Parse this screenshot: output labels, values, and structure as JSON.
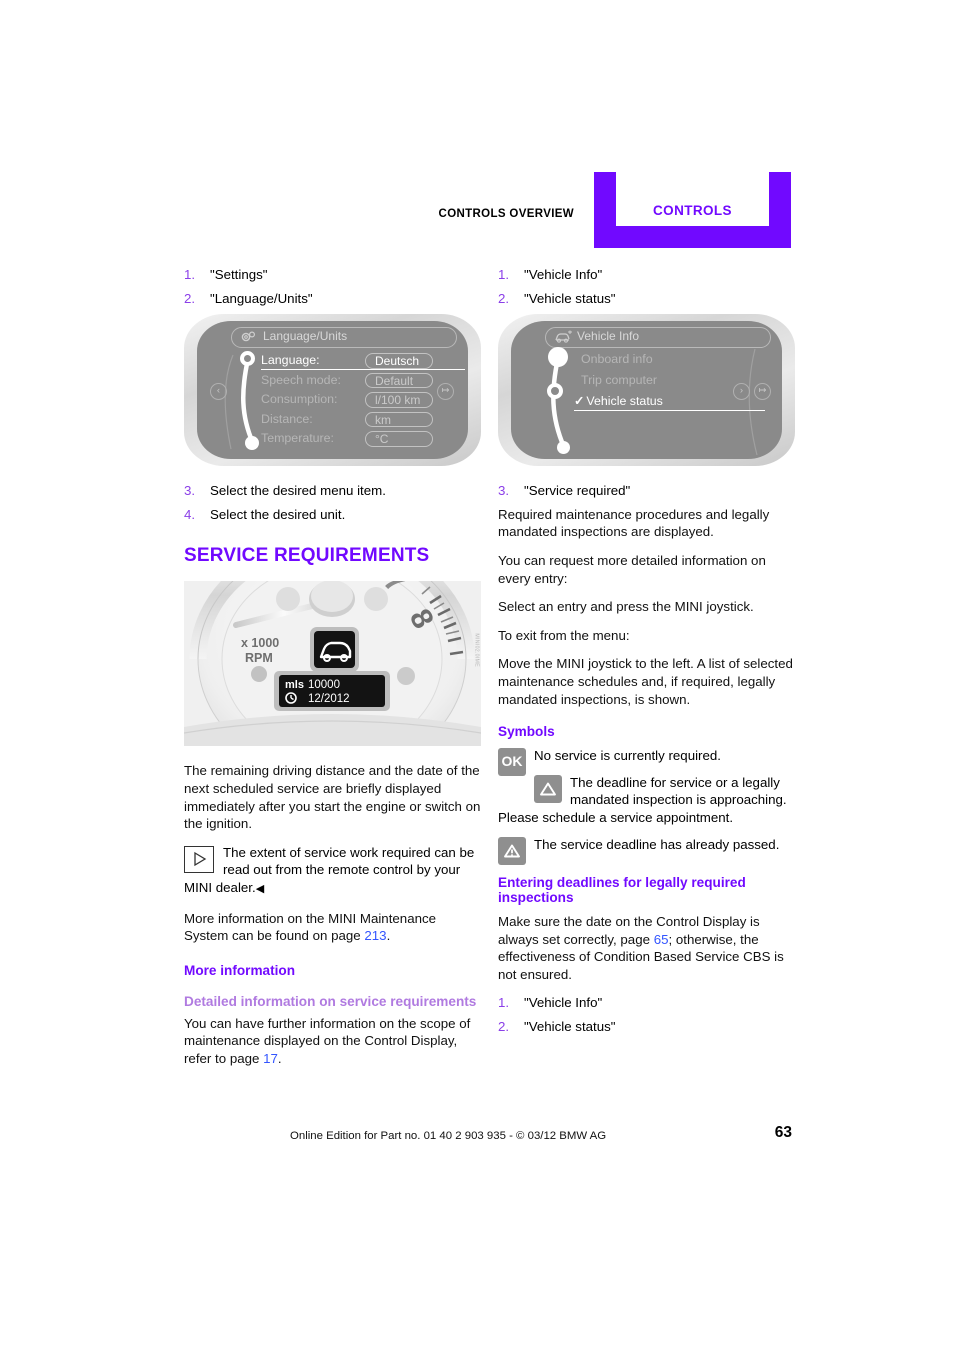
{
  "header": {
    "overview_label": "CONTROLS OVERVIEW",
    "tab_label": "CONTROLS",
    "accent_color": "#7109ff"
  },
  "left_column": {
    "steps_top": [
      {
        "num": "1.",
        "text": "\"Settings\""
      },
      {
        "num": "2.",
        "text": "\"Language/Units\""
      }
    ],
    "display_figure": {
      "title": "Language/Units",
      "title_icon": "gears-icon",
      "rows": [
        {
          "label": "Language:",
          "value": "Deutsch",
          "selected": true
        },
        {
          "label": "Speech mode:",
          "value": "Default",
          "selected": false
        },
        {
          "label": "Consumption:",
          "value": "l/100 km",
          "selected": false
        },
        {
          "label": "Distance:",
          "value": "km",
          "selected": false
        },
        {
          "label": "Temperature:",
          "value": "°C",
          "selected": false
        }
      ],
      "left_button": "‹",
      "right_button": "↦"
    },
    "steps_bottom": [
      {
        "num": "3.",
        "text": "Select the desired menu item."
      },
      {
        "num": "4.",
        "text": "Select the desired unit."
      }
    ],
    "section_title": "SERVICE REQUIREMENTS",
    "speedo_figure": {
      "scale_label_1": "x 1000",
      "scale_label_2": "RPM",
      "tick_8": "8",
      "display_distance_unit": "mls",
      "display_distance_value": "10000",
      "display_date": "12/2012",
      "credit": "MINI02.0IME"
    },
    "paragraph_1": "The remaining driving distance and the date of the next scheduled service are briefly displayed immediately after you start the engine or switch on the ignition.",
    "note": {
      "icon": "triangle-right-icon",
      "text": "The extent of service work required can be read out from the remote control by your MINI dealer.",
      "end_marker": "◀"
    },
    "paragraph_2_pre": "More information on the MINI Maintenance System can be found on page ",
    "paragraph_2_ref": "213",
    "paragraph_2_post": ".",
    "more_information_heading": "More information",
    "detailed_info_heading": "Detailed information on service requirements",
    "detailed_info_pre": "You can have further information on the scope of maintenance displayed on the Control Display, refer to page ",
    "detailed_info_ref": "17",
    "detailed_info_post": "."
  },
  "right_column": {
    "steps_top": [
      {
        "num": "1.",
        "text": "\"Vehicle Info\""
      },
      {
        "num": "2.",
        "text": "\"Vehicle status\""
      }
    ],
    "display_figure": {
      "title": "Vehicle Info",
      "title_icon": "car-info-icon",
      "rows": [
        {
          "label": "Onboard info",
          "selected": false,
          "checked": false
        },
        {
          "label": "Trip computer",
          "selected": false,
          "checked": false
        },
        {
          "label": "Vehicle status",
          "selected": true,
          "checked": true
        }
      ],
      "right_button_1": "›",
      "right_button_2": "↦"
    },
    "step_3": {
      "num": "3.",
      "text": "\"Service required\""
    },
    "paragraph_1": "Required maintenance procedures and legally mandated inspections are displayed.",
    "paragraph_2": "You can request more detailed information on every entry:",
    "paragraph_3": "Select an entry and press the MINI joystick.",
    "paragraph_4": "To exit from the menu:",
    "paragraph_5": "Move the MINI joystick to the left. A list of selected maintenance schedules and, if required, legally mandated inspections, is shown.",
    "symbols_heading": "Symbols",
    "symbols": [
      {
        "icon": "ok-badge-icon",
        "glyph": "OK",
        "text": "No service is currently required."
      },
      {
        "icon": "warning-triangle-icon",
        "glyph": "△",
        "text": "The deadline for service or a legally mandated inspection is approaching. Please schedule a service appointment."
      },
      {
        "icon": "alert-triangle-icon",
        "glyph": "⚠",
        "text": "The service deadline has already passed."
      }
    ],
    "deadlines_heading": "Entering deadlines for legally required inspections",
    "deadlines_pre": "Make sure the date on the Control Display is always set correctly, page ",
    "deadlines_ref": "65",
    "deadlines_post": "; otherwise, the effectiveness of Condition Based Service CBS is not ensured.",
    "deadlines_steps": [
      {
        "num": "1.",
        "text": "\"Vehicle Info\""
      },
      {
        "num": "2.",
        "text": "\"Vehicle status\""
      }
    ]
  },
  "footer": {
    "text": "Online Edition for Part no. 01 40 2 903 935 - © 03/12 BMW AG",
    "page_number": "63"
  }
}
